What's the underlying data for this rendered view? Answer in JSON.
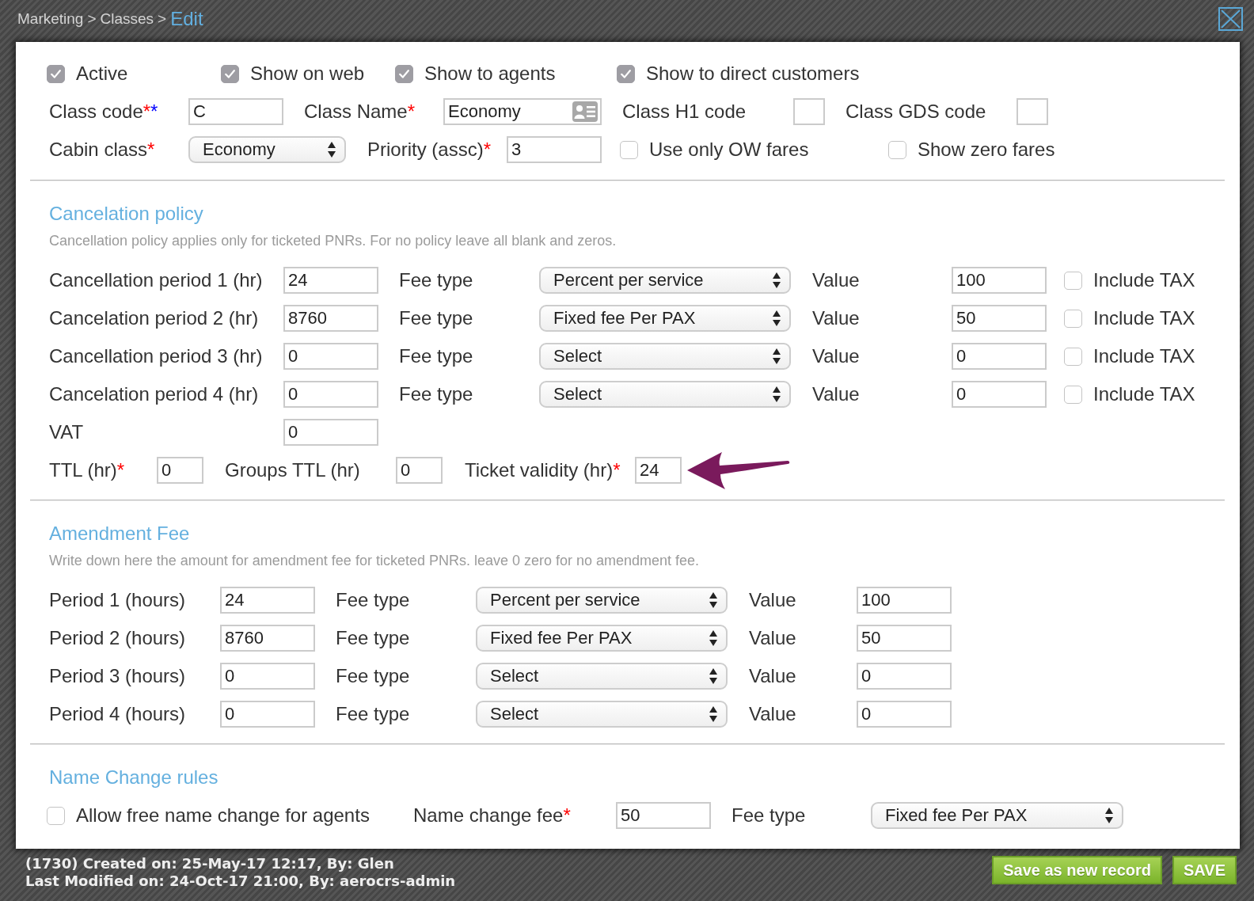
{
  "breadcrumb": {
    "separator": ">",
    "items": [
      {
        "label": "Marketing",
        "current": false
      },
      {
        "label": "Classes",
        "current": false
      },
      {
        "label": "Edit",
        "current": true
      }
    ]
  },
  "general": {
    "flags": [
      {
        "label": "Active",
        "checked": true
      },
      {
        "label": "Show on web",
        "checked": true
      },
      {
        "label": "Show to agents",
        "checked": true
      },
      {
        "label": "Show to direct customers",
        "checked": true
      }
    ],
    "codes": [
      {
        "kind": "text",
        "label": "Class code",
        "marks": [
          {
            "text": "*",
            "color": "#ff0000"
          },
          {
            "text": "*",
            "color": "#0000ff"
          }
        ],
        "value": "C"
      },
      {
        "kind": "contact",
        "label": "Class Name",
        "marks": [
          {
            "text": "*",
            "color": "#ff0000"
          }
        ],
        "value": "Economy"
      },
      {
        "kind": "short",
        "label": "Class H1 code"
      },
      {
        "kind": "short",
        "label": "Class GDS code"
      }
    ],
    "cabin_class": {
      "label": "Cabin class",
      "marks": [
        {
          "text": "*",
          "color": "#ff0000"
        }
      ],
      "value": "Economy"
    },
    "priority": {
      "label": "Priority (assc)",
      "marks": [
        {
          "text": "*",
          "color": "#ff0000"
        }
      ],
      "value": "3"
    },
    "options": [
      {
        "label": "Use only OW fares",
        "checked": false
      },
      {
        "label": "Show zero fares",
        "checked": false
      }
    ]
  },
  "cancellation_policy": {
    "title": "Cancelation policy",
    "note": "Cancellation policy applies only for ticketed PNRs. For no policy leave all blank and zeros.",
    "periods": [
      {
        "label": "Cancellation period 1 (hr)",
        "hours": "24",
        "fee_type_label": "Fee type",
        "fee_type": "Percent per service",
        "value_label": "Value",
        "value": "100",
        "include_tax_label": "Include TAX",
        "include_tax": false
      },
      {
        "label": "Cancelation period 2 (hr)",
        "hours": "8760",
        "fee_type_label": "Fee type",
        "fee_type": "Fixed fee Per PAX",
        "value_label": "Value",
        "value": "50",
        "include_tax_label": "Include TAX",
        "include_tax": false
      },
      {
        "label": "Cancellation period 3 (hr)",
        "hours": "0",
        "fee_type_label": "Fee type",
        "fee_type": "Select",
        "value_label": "Value",
        "value": "0",
        "include_tax_label": "Include TAX",
        "include_tax": false
      },
      {
        "label": "Cancelation period 4 (hr)",
        "hours": "0",
        "fee_type_label": "Fee type",
        "fee_type": "Select",
        "value_label": "Value",
        "value": "0",
        "include_tax_label": "Include TAX",
        "include_tax": false
      }
    ],
    "vat": {
      "label": "VAT",
      "value": "0"
    },
    "ttl_fields": [
      {
        "label": "TTL (hr)",
        "marks": [
          {
            "text": "*",
            "color": "#ff0000"
          }
        ],
        "value": "0",
        "highlighted": false
      },
      {
        "label": "Groups TTL (hr)",
        "value": "0",
        "highlighted": false
      },
      {
        "label": "Ticket validity (hr)",
        "marks": [
          {
            "text": "*",
            "color": "#ff0000"
          }
        ],
        "value": "24",
        "highlighted": true
      }
    ]
  },
  "amendment_fee": {
    "title": "Amendment Fee",
    "note": "Write down here the amount for amendment fee for ticketed PNRs. leave 0 zero for no amendment fee.",
    "periods": [
      {
        "label": "Period 1 (hours)",
        "hours": "24",
        "fee_type_label": "Fee type",
        "fee_type": "Percent per service",
        "value_label": "Value",
        "value": "100"
      },
      {
        "label": "Period 2 (hours)",
        "hours": "8760",
        "fee_type_label": "Fee type",
        "fee_type": "Fixed fee Per PAX",
        "value_label": "Value",
        "value": "50"
      },
      {
        "label": "Period 3 (hours)",
        "hours": "0",
        "fee_type_label": "Fee type",
        "fee_type": "Select",
        "value_label": "Value",
        "value": "0"
      },
      {
        "label": "Period 4 (hours)",
        "hours": "0",
        "fee_type_label": "Fee type",
        "fee_type": "Select",
        "value_label": "Value",
        "value": "0"
      }
    ]
  },
  "name_change_rules": {
    "title": "Name Change rules",
    "allow_free": {
      "label": "Allow free name change for agents",
      "checked": false
    },
    "fee": {
      "label": "Name change fee",
      "marks": [
        {
          "text": "*",
          "color": "#ff0000"
        }
      ],
      "value": "50"
    },
    "fee_type": {
      "label": "Fee type",
      "value": "Fixed fee Per PAX"
    }
  },
  "footer": {
    "lines": [
      "(1730) Created on: 25-May-17 12:17, By: Glen",
      "Last Modified on: 24-Oct-17 21:00, By: aerocrs-admin"
    ],
    "buttons": [
      {
        "label": "Save as new record"
      },
      {
        "label": "SAVE"
      }
    ]
  }
}
